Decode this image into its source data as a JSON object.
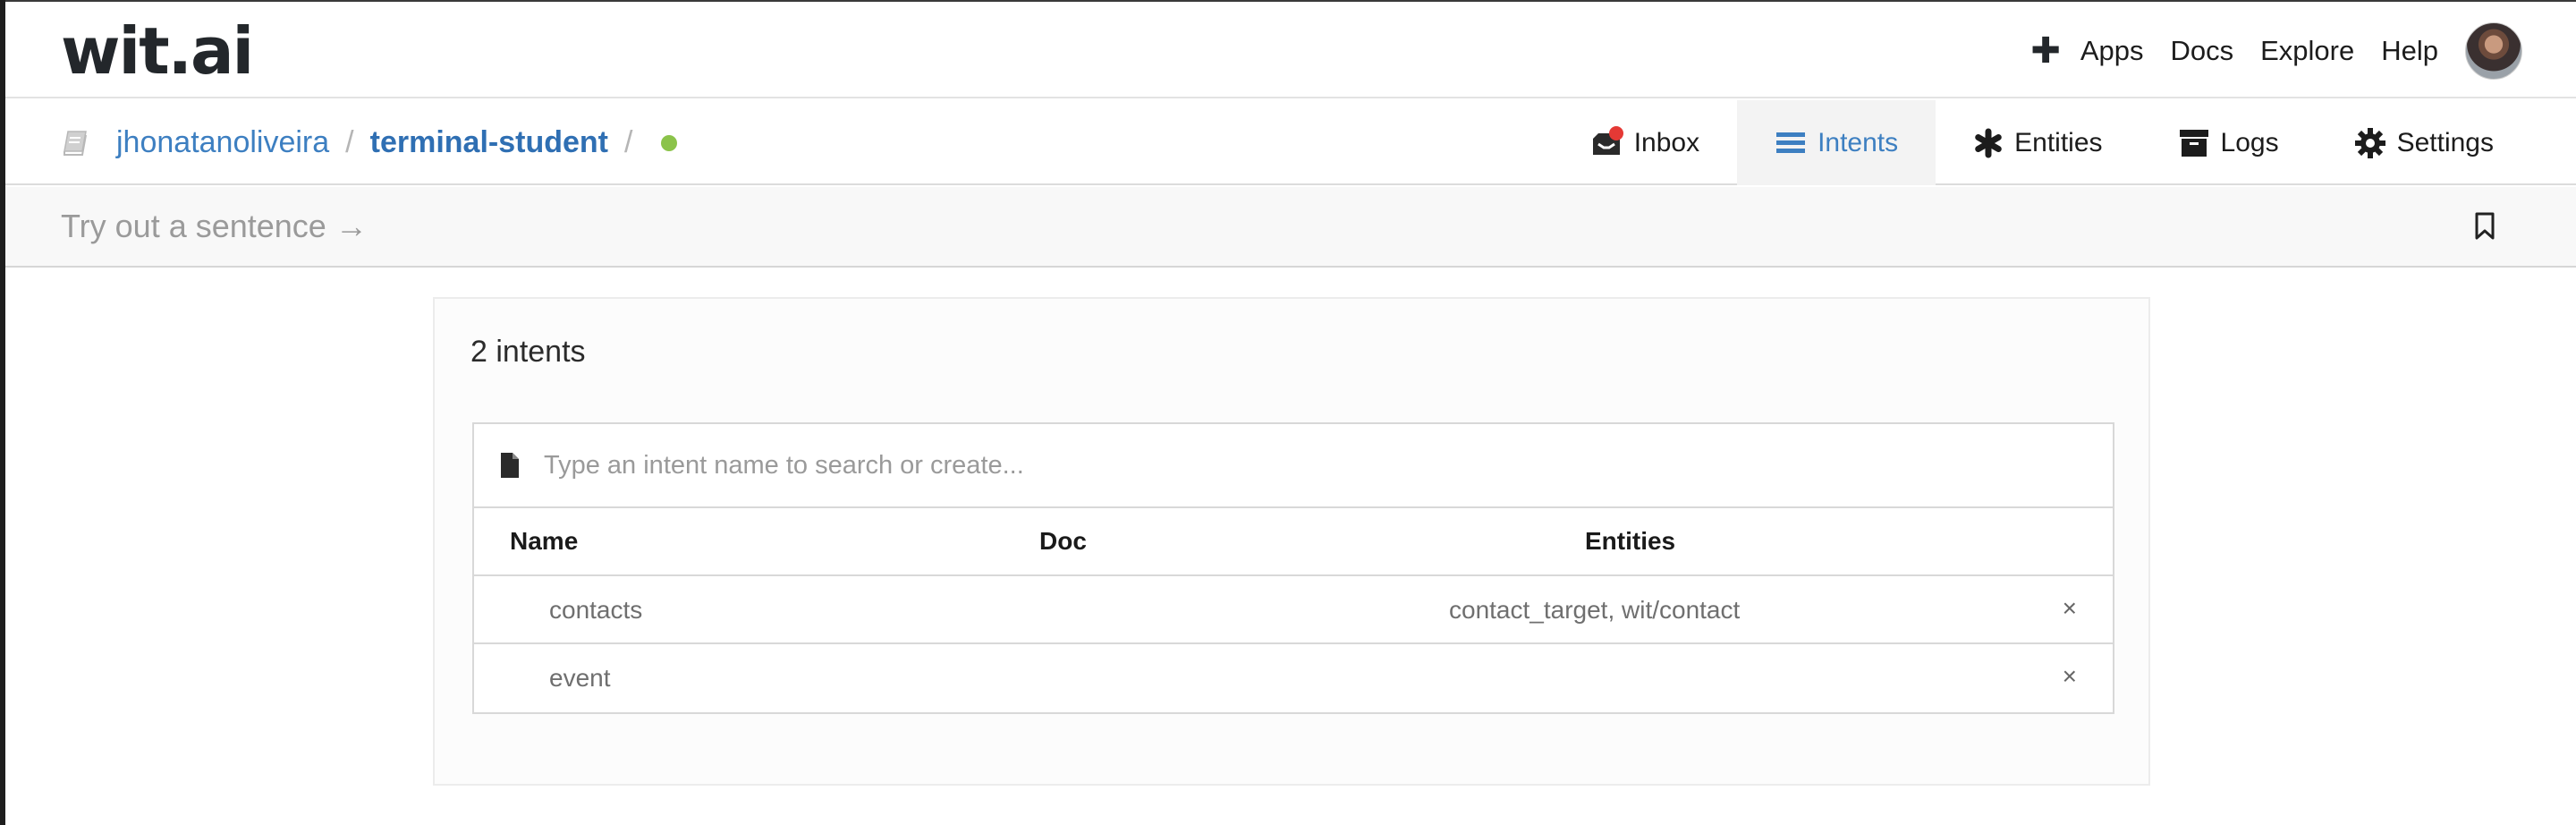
{
  "brand": {
    "logo_text": "wit.ai"
  },
  "top_nav": {
    "add_icon": "plus-icon",
    "links": [
      "Apps",
      "Docs",
      "Explore",
      "Help"
    ]
  },
  "breadcrumb": {
    "user": "jhonatanoliveira",
    "separator": "/",
    "app": "terminal-student",
    "status_color": "#8bc34a"
  },
  "tabs": [
    {
      "label": "Inbox",
      "icon": "inbox-icon",
      "active": false,
      "has_notification": true
    },
    {
      "label": "Intents",
      "icon": "list-icon",
      "active": true
    },
    {
      "label": "Entities",
      "icon": "asterisk-icon",
      "active": false
    },
    {
      "label": "Logs",
      "icon": "archive-icon",
      "active": false
    },
    {
      "label": "Settings",
      "icon": "gear-icon",
      "active": false
    }
  ],
  "try_bar": {
    "placeholder": "Try out a sentence →",
    "bookmark_icon": "bookmark-icon"
  },
  "intents_panel": {
    "title": "2 intents",
    "search_placeholder": "Type an intent name to search or create...",
    "columns": {
      "name": "Name",
      "doc": "Doc",
      "entities": "Entities"
    },
    "rows": [
      {
        "name": "contacts",
        "doc": "",
        "entities": "contact_target, wit/contact",
        "delete": "×"
      },
      {
        "name": "event",
        "doc": "",
        "entities": "",
        "delete": "×"
      }
    ]
  },
  "colors": {
    "accent": "#3d7fc1",
    "notification": "#e53935",
    "status_ok": "#8bc34a"
  }
}
